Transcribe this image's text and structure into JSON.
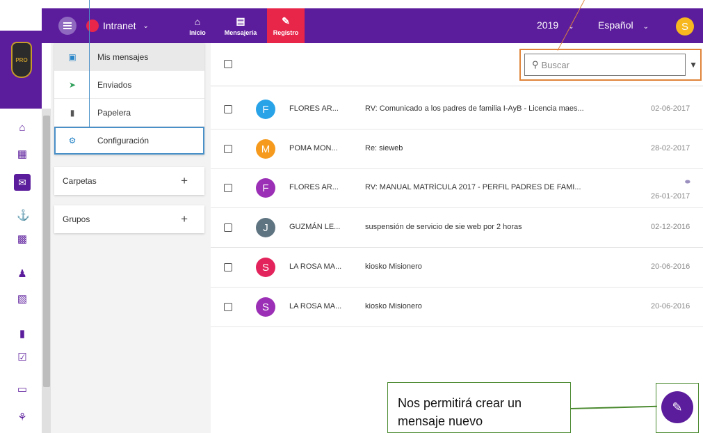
{
  "topbar": {
    "app_label": "Intranet",
    "nav": [
      {
        "label": "Inicio",
        "icon": "home-icon"
      },
      {
        "label": "Mensajería",
        "icon": "mailbox-icon"
      },
      {
        "label": "Registro",
        "icon": "edit-note-icon"
      }
    ],
    "year": "2019",
    "language": "Español",
    "user_initial": "S",
    "colors": {
      "brand": "#5c1d9c",
      "active_tab": "#e8264a",
      "user": "#f6b81e"
    }
  },
  "folders": [
    {
      "label": "Mis mensajes",
      "icon": "inbox-icon",
      "selected": true
    },
    {
      "label": "Enviados",
      "icon": "send-icon"
    },
    {
      "label": "Papelera",
      "icon": "trash-icon"
    },
    {
      "label": "Configuración",
      "icon": "gear-icon"
    }
  ],
  "groups": [
    {
      "label": "Carpetas",
      "action": "+"
    },
    {
      "label": "Grupos",
      "action": "+"
    }
  ],
  "search": {
    "placeholder": "Buscar"
  },
  "messages": [
    {
      "initial": "F",
      "color": "#29a3e8",
      "from": "FLORES AR...",
      "subject": "RV: Comunicado a los padres de familia I-AyB - Licencia maes...",
      "date": "02-06-2017",
      "attachment": false
    },
    {
      "initial": "M",
      "color": "#f59a1c",
      "from": "POMA MON...",
      "subject": "Re: sieweb",
      "date": "28-02-2017",
      "attachment": false
    },
    {
      "initial": "F",
      "color": "#9b2fb5",
      "from": "FLORES AR...",
      "subject": "RV: MANUAL MATRÍCULA 2017 - PERFIL PADRES DE FAMI...",
      "date": "26-01-2017",
      "attachment": true
    },
    {
      "initial": "J",
      "color": "#5f7481",
      "from": "GUZMÁN LE...",
      "subject": "suspensión de servicio de sie web por 2 horas",
      "date": "02-12-2016",
      "attachment": false
    },
    {
      "initial": "S",
      "color": "#e3245c",
      "from": "LA ROSA MA...",
      "subject": "kiosko Misionero",
      "date": "20-06-2016",
      "attachment": false
    },
    {
      "initial": "S",
      "color": "#9b2fb5",
      "from": "LA ROSA MA...",
      "subject": "kiosko Misionero",
      "date": "20-06-2016",
      "attachment": false
    }
  ],
  "callout": {
    "text": "Nos permitirá crear un mensaje nuevo"
  },
  "rail_icons": [
    "home-icon",
    "calendar-icon",
    "mail-icon",
    "institution-icon",
    "id-card-icon",
    "person-icon",
    "library-icon",
    "book-icon",
    "checkbox-icon",
    "document-icon",
    "handshake-icon"
  ]
}
